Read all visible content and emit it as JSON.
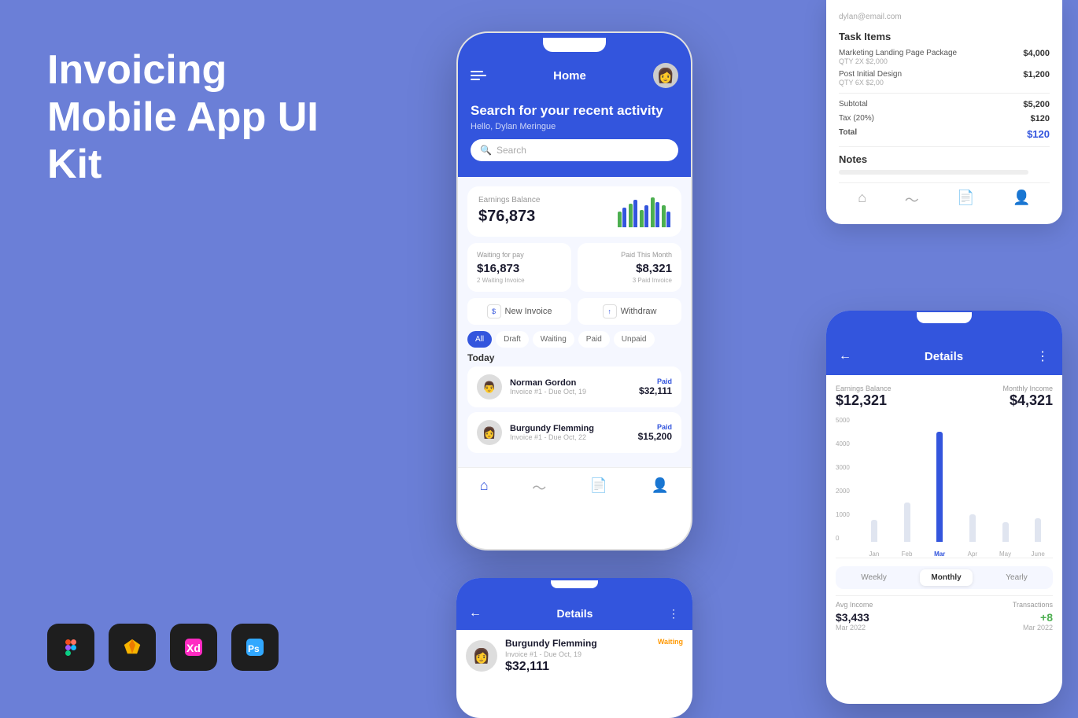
{
  "hero": {
    "title": "Invoicing\nMobile App UI Kit"
  },
  "main_phone": {
    "header": {
      "title": "Home"
    },
    "search_headline": "Search for your recent activity",
    "search_subline": "Hello, Dylan Meringue",
    "search_placeholder": "Search",
    "earnings": {
      "label": "Earnings Balance",
      "amount": "$76,873"
    },
    "waiting": {
      "label": "Waiting for pay",
      "amount": "$16,873",
      "sub": "2 Waiting Invoice"
    },
    "paid_month": {
      "label": "Paid This Month",
      "amount": "$8,321",
      "sub": "3 Paid Invoice"
    },
    "actions": {
      "new_invoice": "New Invoice",
      "withdraw": "Withdraw"
    },
    "filters": [
      "All",
      "Draft",
      "Waiting",
      "Paid",
      "Unpaid"
    ],
    "today_label": "Today",
    "invoices": [
      {
        "name": "Norman Gordon",
        "detail": "Invoice #1 - Due Oct, 19",
        "status": "Paid",
        "amount": "$32,111"
      },
      {
        "name": "Burgundy Flemming",
        "detail": "Invoice #1 - Due Oct, 22",
        "status": "Paid",
        "amount": "$15,200"
      }
    ]
  },
  "invoice_panel": {
    "email": "dylan@email.com",
    "section_title": "Task Items",
    "rows": [
      {
        "label": "Marketing Landing Page Package",
        "sublabel": "QTY 2X $2,000",
        "value": "$4,000"
      },
      {
        "label": "Post Initial Design",
        "sublabel": "QTY 6X $2,00",
        "value": "$1,200"
      },
      {
        "label": "Subtotal",
        "sublabel": "",
        "value": "$5,200"
      },
      {
        "label": "Tax (20%)",
        "sublabel": "",
        "value": "$120"
      },
      {
        "label": "Total",
        "sublabel": "",
        "value": "$120",
        "highlight": true
      }
    ],
    "notes_label": "Notes"
  },
  "details_phone": {
    "title": "Details",
    "earnings_balance": {
      "label": "Earnings Balance",
      "value": "$12,321"
    },
    "monthly_income": {
      "label": "Monthly Income",
      "value": "$4,321"
    },
    "chart": {
      "y_labels": [
        "5000",
        "4000",
        "3000",
        "2000",
        "1000",
        "0"
      ],
      "x_labels": [
        "Jan",
        "Feb",
        "Mar",
        "Apr",
        "May",
        "June"
      ],
      "active_index": 2,
      "bars": [
        20,
        35,
        100,
        25,
        18,
        22
      ]
    },
    "periods": [
      "Weekly",
      "Monthly",
      "Yearly"
    ],
    "active_period": "Monthly",
    "avg_income": {
      "label": "Avg Income",
      "value": "$3,433",
      "sub": "Mar 2022"
    },
    "transactions": {
      "label": "Transactions",
      "value": "+8",
      "sub": "Mar 2022"
    }
  },
  "bottom_phone": {
    "title": "Details",
    "invoice": {
      "name": "Burgundy Flemming",
      "detail": "Invoice #1 - Due Oct, 19",
      "status": "Waiting",
      "amount": "$32,111"
    }
  },
  "tools": [
    {
      "name": "Figma",
      "symbol": "🎨"
    },
    {
      "name": "Sketch",
      "symbol": "💎"
    },
    {
      "name": "XD",
      "symbol": "🔷"
    },
    {
      "name": "Photoshop",
      "symbol": "🅿"
    }
  ]
}
